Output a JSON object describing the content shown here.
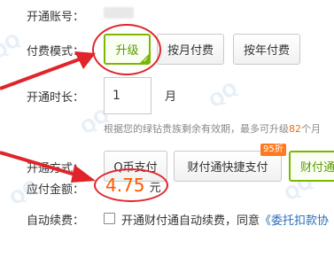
{
  "form": {
    "account_label": "开通账号：",
    "payment_mode_label": "付费模式：",
    "payment_modes": [
      {
        "label": "升级",
        "selected": true
      },
      {
        "label": "按月付费",
        "selected": false
      },
      {
        "label": "按年付费",
        "selected": false
      }
    ],
    "duration_label": "开通时长：",
    "duration_value": "1",
    "duration_unit": "月",
    "hint_prefix": "根据您的绿钻贵族剩余有效期，最多可升级",
    "hint_number": "82",
    "hint_suffix": "个月",
    "method_label": "开通方式：",
    "methods": [
      {
        "label": "Q币支付",
        "selected": false
      },
      {
        "label": "财付通快捷支付",
        "selected": false
      },
      {
        "label": "财付通",
        "selected": true
      }
    ],
    "discount_badge": "95折",
    "amount_label": "应付金额：",
    "amount_value": "4.75",
    "amount_unit": "元",
    "auto_renew_label": "自动续费：",
    "auto_renew_text": "开通财付通自动续费，同意",
    "auto_renew_link": "《委托扣款协"
  },
  "colors": {
    "accent_green": "#7ab800",
    "annotation_red": "#e0242a",
    "price_orange": "#ff5a00",
    "link_blue": "#2a6fb8"
  }
}
